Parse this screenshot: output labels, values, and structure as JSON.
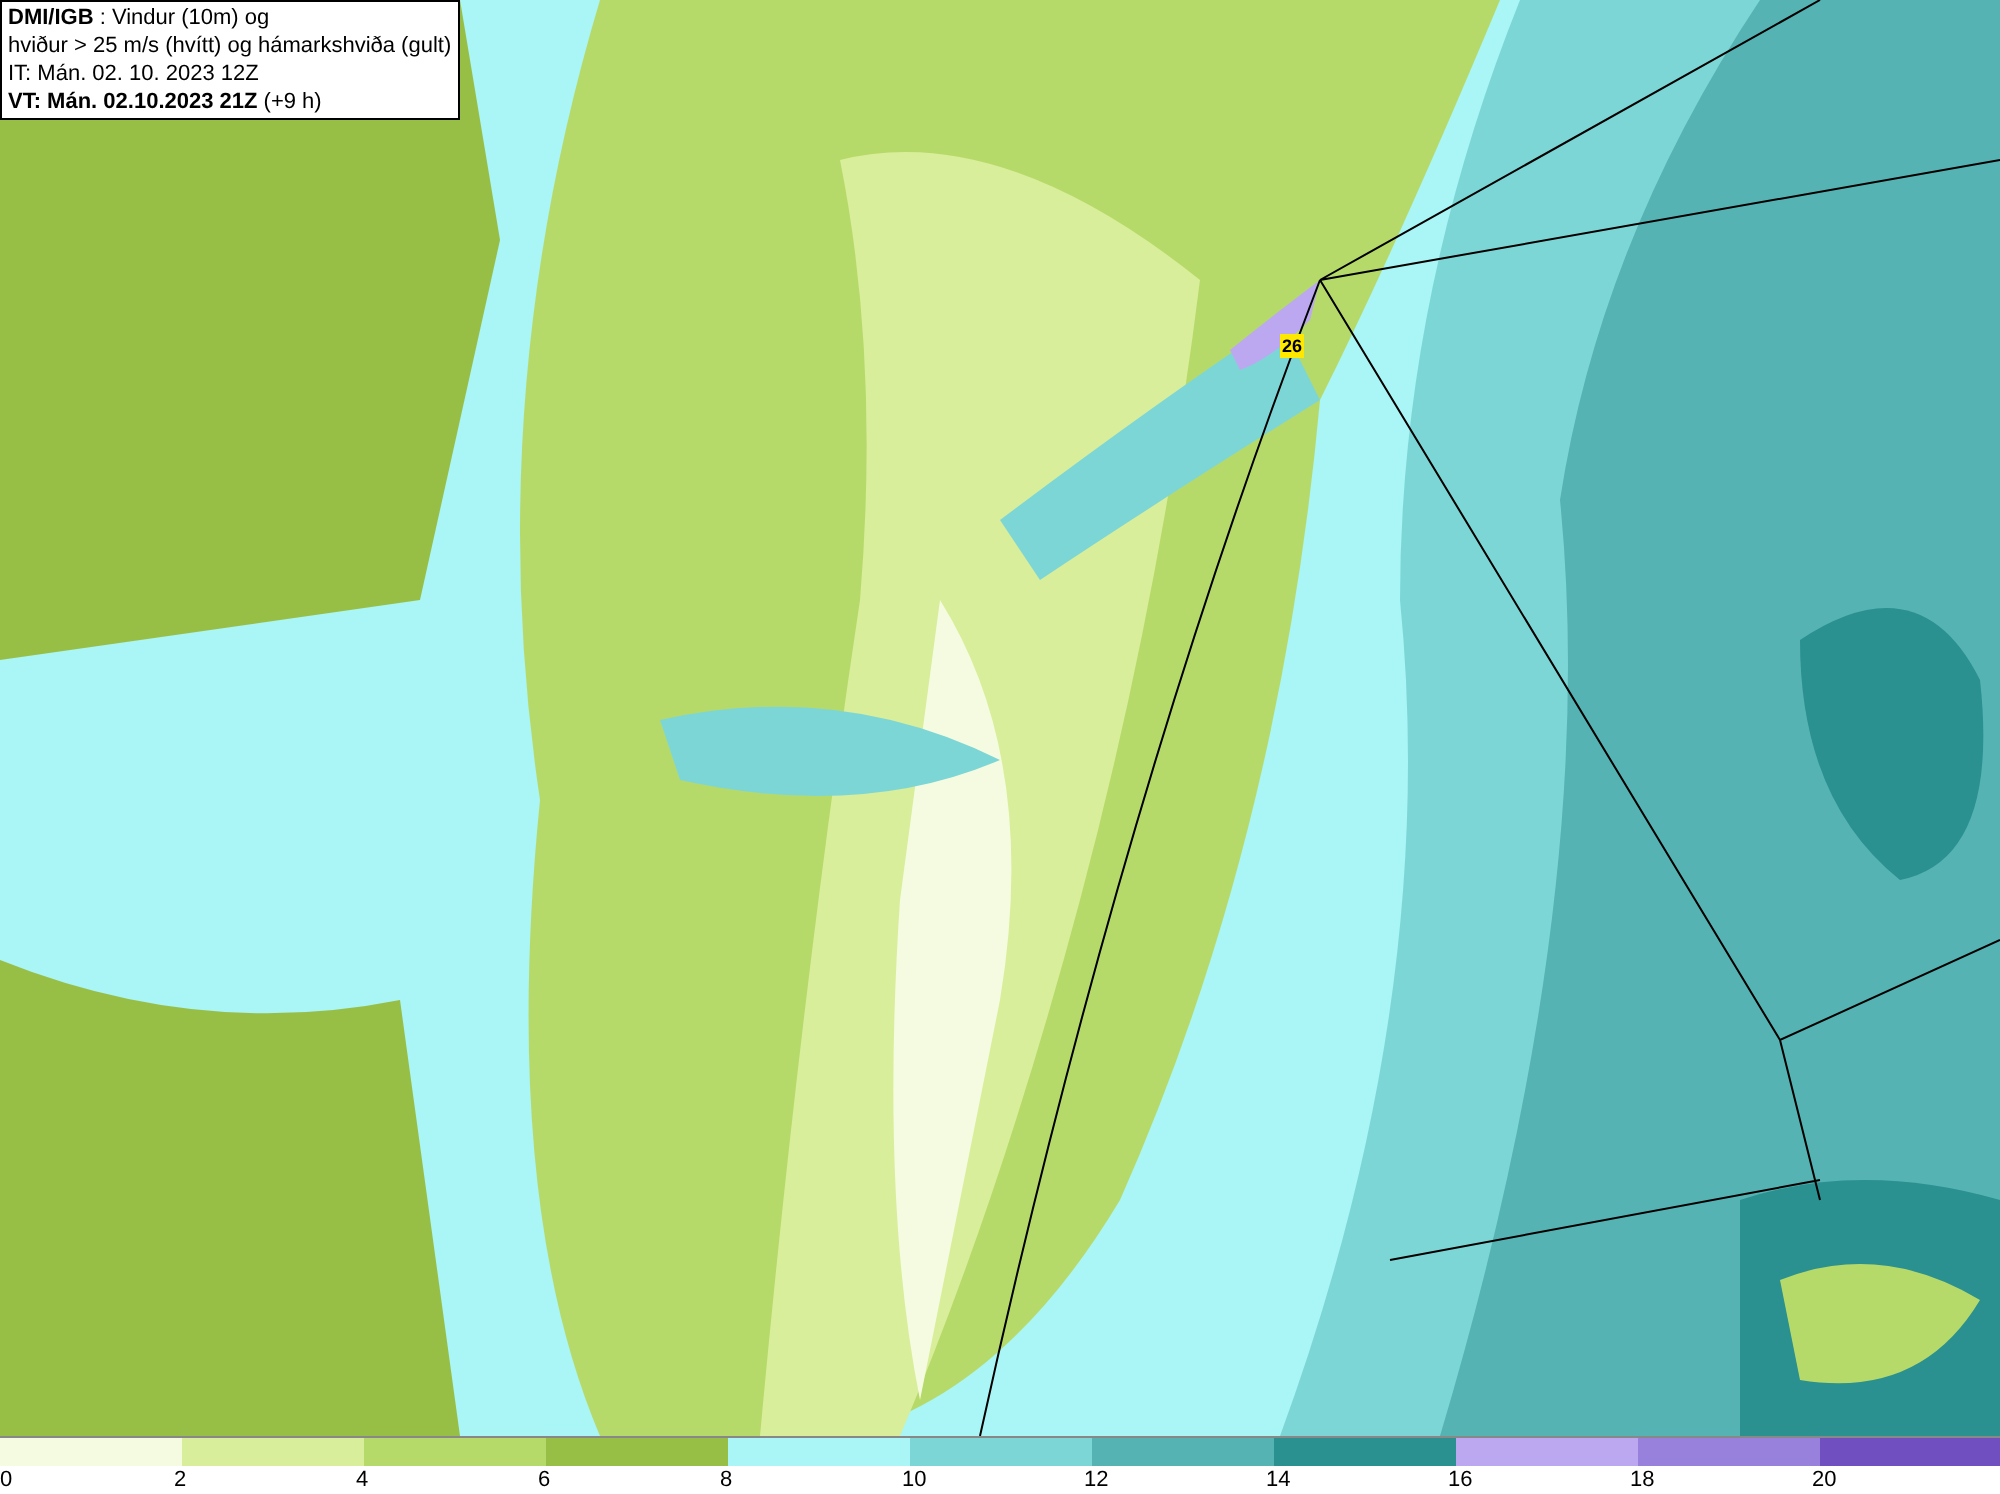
{
  "title_box": {
    "lines": [
      "**DMI/IGB** : Vindur (10m) og",
      "hviður > 25 m/s (hvítt) og hámarkshviða (gult)",
      "IT: Mán. 02. 10. 2023 12Z",
      "**VT: Mán. 02.10.2023 21Z** (+9 h)"
    ]
  },
  "map": {
    "gust_label": "26"
  },
  "legend": {
    "segments": [
      {
        "color": "#f5fbe0"
      },
      {
        "color": "#d8ee9a"
      },
      {
        "color": "#b6da6a"
      },
      {
        "color": "#98bf45"
      },
      {
        "color": "#aaf5f5"
      },
      {
        "color": "#7dd6d6"
      },
      {
        "color": "#55b3b3"
      },
      {
        "color": "#2a9090"
      },
      {
        "color": "#bba8f0"
      },
      {
        "color": "#9880dd"
      },
      {
        "color": "#7050c0"
      }
    ],
    "ticks": [
      "0",
      "2",
      "4",
      "6",
      "8",
      "10",
      "12",
      "14",
      "16",
      "18",
      "20"
    ]
  }
}
